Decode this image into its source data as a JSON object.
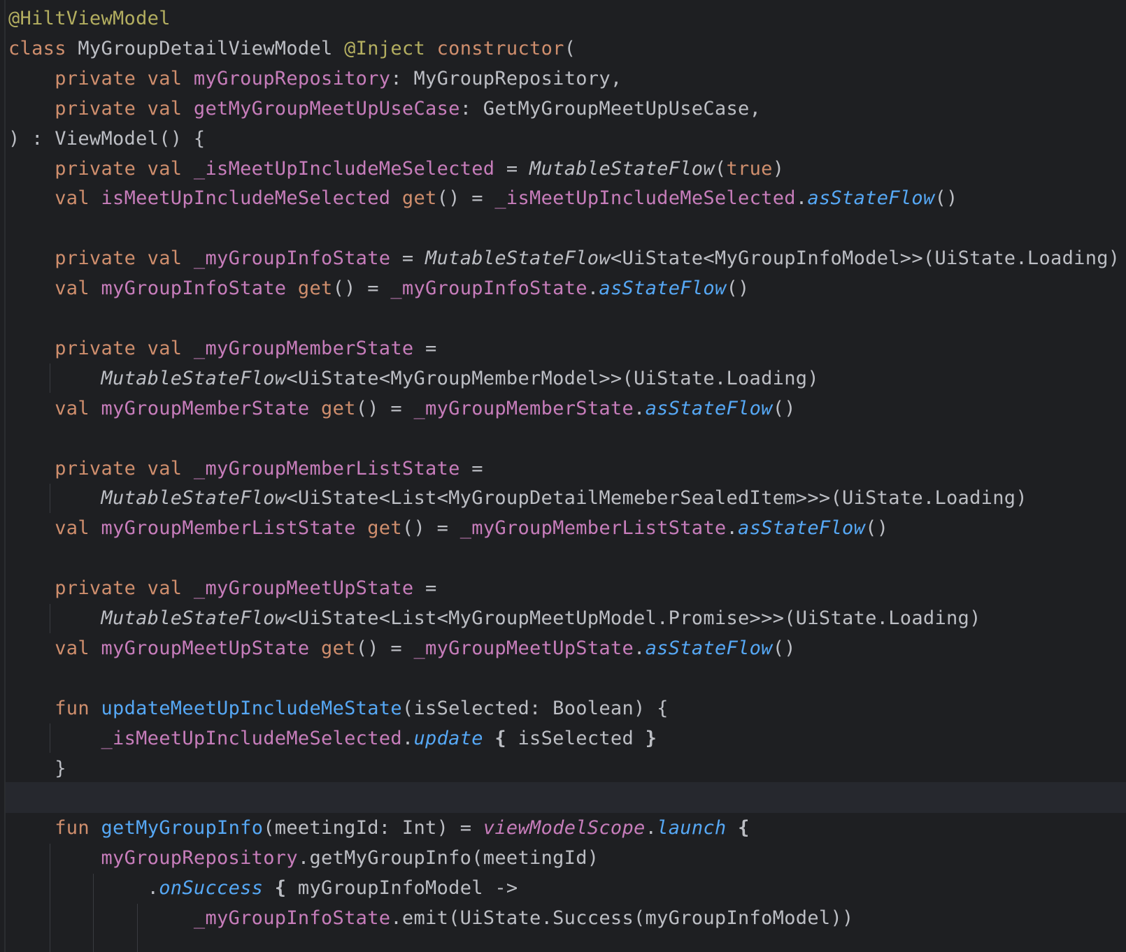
{
  "editor": {
    "theme_colors": {
      "background": "#1e1f22",
      "keyword": "#cf8e6d",
      "annotation": "#b3ae60",
      "property": "#c77dbb",
      "function": "#56a8f5",
      "text": "#bcbec4"
    },
    "lines": [
      [
        {
          "t": "@HiltViewModel",
          "c": "ann"
        }
      ],
      [
        {
          "t": "class ",
          "c": "kw"
        },
        {
          "t": "MyGroupDetailViewModel ",
          "c": "txt"
        },
        {
          "t": "@Inject ",
          "c": "ann"
        },
        {
          "t": "constructor",
          "c": "kw"
        },
        {
          "t": "(",
          "c": "txt"
        }
      ],
      [
        {
          "t": "    ",
          "c": "txt"
        },
        {
          "t": "private val ",
          "c": "kw"
        },
        {
          "t": "myGroupRepository",
          "c": "prop"
        },
        {
          "t": ": MyGroupRepository,",
          "c": "txt"
        }
      ],
      [
        {
          "t": "    ",
          "c": "txt"
        },
        {
          "t": "private val ",
          "c": "kw"
        },
        {
          "t": "getMyGroupMeetUpUseCase",
          "c": "prop"
        },
        {
          "t": ": GetMyGroupMeetUpUseCase,",
          "c": "txt"
        }
      ],
      [
        {
          "t": ") : ViewModel() {",
          "c": "txt"
        }
      ],
      [
        {
          "t": "    ",
          "c": "txt"
        },
        {
          "t": "private val ",
          "c": "kw"
        },
        {
          "t": "_isMeetUpIncludeMeSelected",
          "c": "prop"
        },
        {
          "t": " = ",
          "c": "txt"
        },
        {
          "t": "MutableStateFlow",
          "c": "ital"
        },
        {
          "t": "(",
          "c": "txt"
        },
        {
          "t": "true",
          "c": "kw"
        },
        {
          "t": ")",
          "c": "txt"
        }
      ],
      [
        {
          "t": "    ",
          "c": "txt"
        },
        {
          "t": "val ",
          "c": "kw"
        },
        {
          "t": "isMeetUpIncludeMeSelected ",
          "c": "prop"
        },
        {
          "t": "get",
          "c": "kw"
        },
        {
          "t": "() = ",
          "c": "txt"
        },
        {
          "t": "_isMeetUpIncludeMeSelected",
          "c": "prop"
        },
        {
          "t": ".",
          "c": "txt"
        },
        {
          "t": "asStateFlow",
          "c": "ext"
        },
        {
          "t": "()",
          "c": "txt"
        }
      ],
      [],
      [
        {
          "t": "    ",
          "c": "txt"
        },
        {
          "t": "private val ",
          "c": "kw"
        },
        {
          "t": "_myGroupInfoState",
          "c": "prop"
        },
        {
          "t": " = ",
          "c": "txt"
        },
        {
          "t": "MutableStateFlow",
          "c": "ital"
        },
        {
          "t": "<UiState<MyGroupInfoModel>>(UiState.Loading)",
          "c": "txt"
        }
      ],
      [
        {
          "t": "    ",
          "c": "txt"
        },
        {
          "t": "val ",
          "c": "kw"
        },
        {
          "t": "myGroupInfoState ",
          "c": "prop"
        },
        {
          "t": "get",
          "c": "kw"
        },
        {
          "t": "() = ",
          "c": "txt"
        },
        {
          "t": "_myGroupInfoState",
          "c": "prop"
        },
        {
          "t": ".",
          "c": "txt"
        },
        {
          "t": "asStateFlow",
          "c": "ext"
        },
        {
          "t": "()",
          "c": "txt"
        }
      ],
      [],
      [
        {
          "t": "    ",
          "c": "txt"
        },
        {
          "t": "private val ",
          "c": "kw"
        },
        {
          "t": "_myGroupMemberState",
          "c": "prop"
        },
        {
          "t": " =",
          "c": "txt"
        }
      ],
      [
        {
          "t": "        ",
          "c": "txt"
        },
        {
          "t": "MutableStateFlow",
          "c": "ital"
        },
        {
          "t": "<UiState<MyGroupMemberModel>>(UiState.Loading)",
          "c": "txt"
        }
      ],
      [
        {
          "t": "    ",
          "c": "txt"
        },
        {
          "t": "val ",
          "c": "kw"
        },
        {
          "t": "myGroupMemberState ",
          "c": "prop"
        },
        {
          "t": "get",
          "c": "kw"
        },
        {
          "t": "() = ",
          "c": "txt"
        },
        {
          "t": "_myGroupMemberState",
          "c": "prop"
        },
        {
          "t": ".",
          "c": "txt"
        },
        {
          "t": "asStateFlow",
          "c": "ext"
        },
        {
          "t": "()",
          "c": "txt"
        }
      ],
      [],
      [
        {
          "t": "    ",
          "c": "txt"
        },
        {
          "t": "private val ",
          "c": "kw"
        },
        {
          "t": "_myGroupMemberListState",
          "c": "prop"
        },
        {
          "t": " =",
          "c": "txt"
        }
      ],
      [
        {
          "t": "        ",
          "c": "txt"
        },
        {
          "t": "MutableStateFlow",
          "c": "ital"
        },
        {
          "t": "<UiState<List<MyGroupDetailMemeberSealedItem>>>(UiState.Loading)",
          "c": "txt"
        }
      ],
      [
        {
          "t": "    ",
          "c": "txt"
        },
        {
          "t": "val ",
          "c": "kw"
        },
        {
          "t": "myGroupMemberListState ",
          "c": "prop"
        },
        {
          "t": "get",
          "c": "kw"
        },
        {
          "t": "() = ",
          "c": "txt"
        },
        {
          "t": "_myGroupMemberListState",
          "c": "prop"
        },
        {
          "t": ".",
          "c": "txt"
        },
        {
          "t": "asStateFlow",
          "c": "ext"
        },
        {
          "t": "()",
          "c": "txt"
        }
      ],
      [],
      [
        {
          "t": "    ",
          "c": "txt"
        },
        {
          "t": "private val ",
          "c": "kw"
        },
        {
          "t": "_myGroupMeetUpState",
          "c": "prop"
        },
        {
          "t": " =",
          "c": "txt"
        }
      ],
      [
        {
          "t": "        ",
          "c": "txt"
        },
        {
          "t": "MutableStateFlow",
          "c": "ital"
        },
        {
          "t": "<UiState<List<MyGroupMeetUpModel.Promise>>>(UiState.Loading)",
          "c": "txt"
        }
      ],
      [
        {
          "t": "    ",
          "c": "txt"
        },
        {
          "t": "val ",
          "c": "kw"
        },
        {
          "t": "myGroupMeetUpState ",
          "c": "prop"
        },
        {
          "t": "get",
          "c": "kw"
        },
        {
          "t": "() = ",
          "c": "txt"
        },
        {
          "t": "_myGroupMeetUpState",
          "c": "prop"
        },
        {
          "t": ".",
          "c": "txt"
        },
        {
          "t": "asStateFlow",
          "c": "ext"
        },
        {
          "t": "()",
          "c": "txt"
        }
      ],
      [],
      [
        {
          "t": "    ",
          "c": "txt"
        },
        {
          "t": "fun ",
          "c": "kw"
        },
        {
          "t": "updateMeetUpIncludeMeState",
          "c": "fn"
        },
        {
          "t": "(isSelected: Boolean) {",
          "c": "txt"
        }
      ],
      [
        {
          "t": "        ",
          "c": "txt"
        },
        {
          "t": "_isMeetUpIncludeMeSelected",
          "c": "prop"
        },
        {
          "t": ".",
          "c": "txt"
        },
        {
          "t": "update",
          "c": "ext"
        },
        {
          "t": " ",
          "c": "txt"
        },
        {
          "t": "{",
          "c": "brace"
        },
        {
          "t": " isSelected ",
          "c": "txt"
        },
        {
          "t": "}",
          "c": "brace"
        }
      ],
      [
        {
          "t": "    }",
          "c": "txt"
        }
      ],
      [],
      [
        {
          "t": "    ",
          "c": "txt"
        },
        {
          "t": "fun ",
          "c": "kw"
        },
        {
          "t": "getMyGroupInfo",
          "c": "fn"
        },
        {
          "t": "(meetingId: Int) = ",
          "c": "txt"
        },
        {
          "t": "viewModelScope",
          "c": "prop ital"
        },
        {
          "t": ".",
          "c": "txt"
        },
        {
          "t": "launch",
          "c": "ext"
        },
        {
          "t": " ",
          "c": "txt"
        },
        {
          "t": "{",
          "c": "brace"
        }
      ],
      [
        {
          "t": "        ",
          "c": "txt"
        },
        {
          "t": "myGroupRepository",
          "c": "prop"
        },
        {
          "t": ".getMyGroupInfo(meetingId)",
          "c": "txt"
        }
      ],
      [
        {
          "t": "            .",
          "c": "txt"
        },
        {
          "t": "onSuccess",
          "c": "ext"
        },
        {
          "t": " ",
          "c": "txt"
        },
        {
          "t": "{",
          "c": "brace"
        },
        {
          "t": " myGroupInfoModel ->",
          "c": "txt"
        }
      ],
      [
        {
          "t": "                ",
          "c": "txt"
        },
        {
          "t": "_myGroupInfoState",
          "c": "prop"
        },
        {
          "t": ".emit(UiState.Success(myGroupInfoModel))",
          "c": "txt"
        }
      ]
    ]
  }
}
